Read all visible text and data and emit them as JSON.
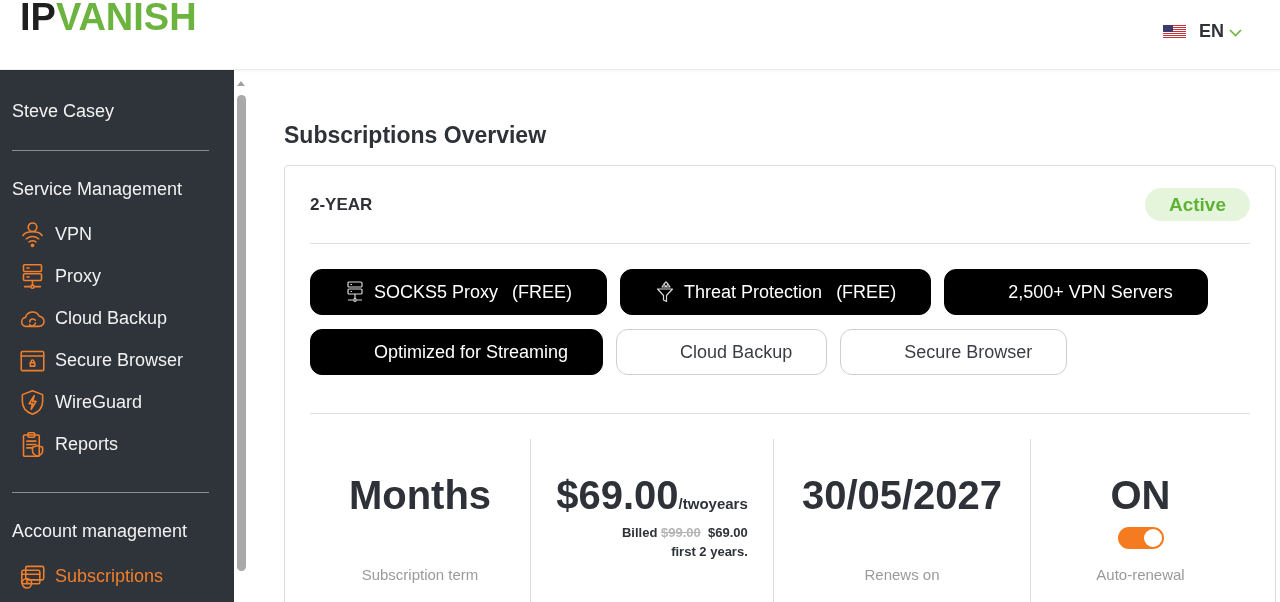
{
  "header": {
    "logo": {
      "prefix": "IP",
      "name": "VANISH"
    },
    "language": "EN"
  },
  "sidebar": {
    "user_name": "Steve Casey",
    "sections": [
      {
        "title": "Service Management",
        "items": [
          {
            "label": "VPN",
            "selected": false
          },
          {
            "label": "Proxy",
            "selected": false
          },
          {
            "label": "Cloud Backup",
            "selected": false
          },
          {
            "label": "Secure Browser",
            "selected": false
          },
          {
            "label": "WireGuard",
            "selected": false
          },
          {
            "label": "Reports",
            "selected": false
          }
        ]
      },
      {
        "title": "Account management",
        "items": [
          {
            "label": "Subscriptions",
            "selected": true
          }
        ]
      }
    ]
  },
  "main": {
    "title": "Subscriptions Overview",
    "subscription": {
      "plan": "2-YEAR",
      "status": "Active",
      "features": [
        {
          "label": "SOCKS5 Proxy",
          "tag": "(FREE)",
          "included": true
        },
        {
          "label": "Threat Protection",
          "tag": "(FREE)",
          "included": true
        },
        {
          "label": "2,500+ VPN Servers",
          "included": true
        },
        {
          "label": "Optimized for Streaming",
          "included": true
        },
        {
          "label": "Cloud Backup",
          "included": false
        },
        {
          "label": "Secure Browser",
          "included": false
        }
      ],
      "stats": [
        {
          "kind": "text",
          "value": "Months",
          "label": "Subscription term"
        },
        {
          "kind": "price",
          "value": "$69.00",
          "unit": "/twoyears",
          "billed_label": "Billed",
          "original_price": "$99.00",
          "billed_price": "$69.00",
          "billed_note": "first 2 years."
        },
        {
          "kind": "text",
          "value": "30/05/2027",
          "label": "Renews on"
        },
        {
          "kind": "toggle",
          "value": "ON",
          "on": true,
          "label": "Auto-renewal"
        }
      ]
    }
  }
}
